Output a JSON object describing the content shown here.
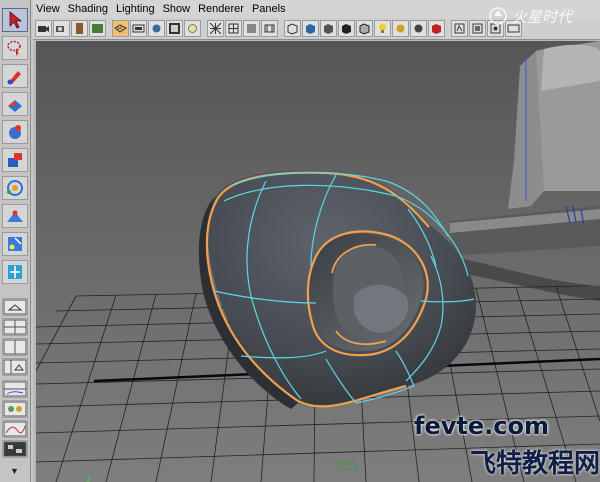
{
  "menu": {
    "items": [
      "View",
      "Shading",
      "Lighting",
      "Show",
      "Renderer",
      "Panels"
    ]
  },
  "toolbox": {
    "tools": [
      "select-tool",
      "lasso-tool",
      "paint-select-tool",
      "move-tool",
      "rotate-tool",
      "scale-tool",
      "universal-manipulator",
      "soft-mod-tool",
      "show-manipulator-tool",
      "last-tool"
    ],
    "layouts": [
      "single-perspective-layout",
      "four-view-layout",
      "side-by-side-layout",
      "persp-outliner-layout",
      "persp-graph-layout",
      "hypershade-layout",
      "graph-editor-layout",
      "uv-editor-layout"
    ]
  },
  "watermarks": {
    "site": "fevte.com",
    "cn": "飞特教程网",
    "logo": "火星时代"
  },
  "colors": {
    "viewport_bg_top": "#5c5c5c",
    "viewport_bg_bottom": "#7a7a7a",
    "grid": "#1e1e1e",
    "object_fill": "#4a4f55",
    "edge_cyan": "#5ed6e6",
    "edge_orange": "#f0a050",
    "accent_menu": "#d4d4d4"
  }
}
